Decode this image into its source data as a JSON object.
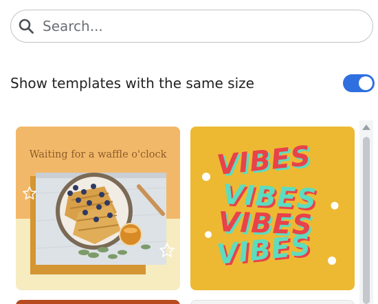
{
  "search": {
    "placeholder": "Search..."
  },
  "filter": {
    "label": "Show templates with the same size",
    "enabled": true
  },
  "templates": [
    {
      "title": "Waiting for a waffle o'clock"
    },
    {
      "lines": [
        "VIBES",
        "VIBES",
        "VIBES",
        "VIBES"
      ]
    }
  ],
  "colors": {
    "toggle_on": "#2f6fe0",
    "waffle_band": "#f2b869",
    "waffle_bg": "#f6ecc0",
    "vibes_bg": "#edb933",
    "vibes_red": "#e8424a",
    "vibes_teal": "#5ddcc0"
  }
}
